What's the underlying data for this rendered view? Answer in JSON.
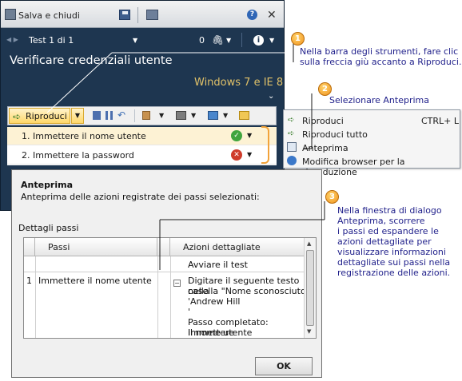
{
  "window": {
    "title_button": "Salva e chiudi",
    "test_nav": "Test 1 di 1",
    "attachment_count": "0",
    "test_title": "Verificare credenziali utente",
    "environment": "Windows 7 e IE 8"
  },
  "toolbar": {
    "play_label": "Riproduci"
  },
  "steps": [
    {
      "label": "1. Immettere il nome utente",
      "status": "passed"
    },
    {
      "label": "2. Immettere la password",
      "status": "failed"
    }
  ],
  "menu": {
    "items": [
      {
        "label": "Riproduci",
        "shortcut": "CTRL+ L"
      },
      {
        "label": "Riproduci tutto",
        "shortcut": ""
      },
      {
        "label": "Anteprima",
        "shortcut": ""
      },
      {
        "label": "Modifica browser per la riproduzione",
        "shortcut": ""
      }
    ]
  },
  "dialog": {
    "title": "Anteprima",
    "description": "Anteprima delle azioni registrate dei passi selezionati:",
    "section": "Dettagli passi",
    "columns": [
      "Passi",
      "Azioni dettagliate"
    ],
    "rows": [
      {
        "num": "",
        "step": "",
        "actions": [
          "Avviare il test"
        ]
      },
      {
        "num": "1",
        "step": "Immettere il nome utente",
        "actions": [
          "Digitare il seguente testo nella",
          "casella \"Nome sconosciuto\"",
          "'Andrew Hill",
          "'",
          "",
          "Passo completato: Immettere",
          "il nome utente"
        ]
      }
    ],
    "ok_label": "OK"
  },
  "callouts": [
    {
      "num": "1",
      "lines": [
        "Nella barra degli strumenti, fare clic",
        "sulla freccia giù accanto a Riproduci."
      ]
    },
    {
      "num": "2",
      "lines": [
        "Selezionare Anteprima"
      ]
    },
    {
      "num": "3",
      "lines": [
        "Nella finestra di dialogo",
        "Anteprima, scorrere",
        "i passi ed espandere le",
        "azioni dettagliate per",
        "visualizzare informazioni",
        "dettagliate sui passi nella",
        "registrazione delle azioni."
      ]
    }
  ],
  "colors": {
    "app_bg": "#1e3650",
    "accent_orange": "#f19420",
    "callout_text": "#1f1f8a",
    "environment_text": "#e0c168"
  }
}
